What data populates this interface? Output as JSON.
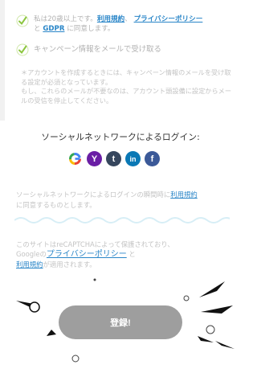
{
  "consent": {
    "age_prefix": "私は20歳以上です。",
    "terms_link": "利用規約",
    "separator": "、",
    "privacy_link": "プライバシーポリシー",
    "and_text": "と",
    "gdpr_link": "GDPR",
    "agree_suffix": "に同意します。",
    "newsletter_label": "キャンペーン情報をメールで受け取る"
  },
  "note": {
    "line1": "＊アカウントを作成するときには、キャンペーン情報のメールを受け取る設定が必須となっています。",
    "line2": "もし、これらのメールが不要なのは、アカウント頭設備に設定からメールの受信を停止してください。"
  },
  "social": {
    "title": "ソーシャルネットワークによるログイン:",
    "agree_prefix": "ソーシャルネットワークによるログインの瞬間時に",
    "agree_link": "利用規約",
    "agree_suffix": "に同意するものとします。",
    "icons": [
      {
        "name": "google-icon",
        "glyph": "G"
      },
      {
        "name": "yahoo-icon",
        "glyph": "Y"
      },
      {
        "name": "tumblr-icon",
        "glyph": "t"
      },
      {
        "name": "linkedin-icon",
        "glyph": "in"
      },
      {
        "name": "facebook-icon",
        "glyph": "f"
      }
    ]
  },
  "recaptcha": {
    "line1": "このサイトはreCAPTCHAによって保護されており、",
    "google_prefix": "Googleの",
    "privacy_link": "プライバシーポリシー",
    "and_text": "と",
    "terms_link": "利用規約",
    "suffix": "が適用されます。"
  },
  "register": {
    "label": "登録!"
  },
  "colors": {
    "accent": "#2a86c8",
    "check": "#8cc63f",
    "button": "#9e9e9e"
  }
}
